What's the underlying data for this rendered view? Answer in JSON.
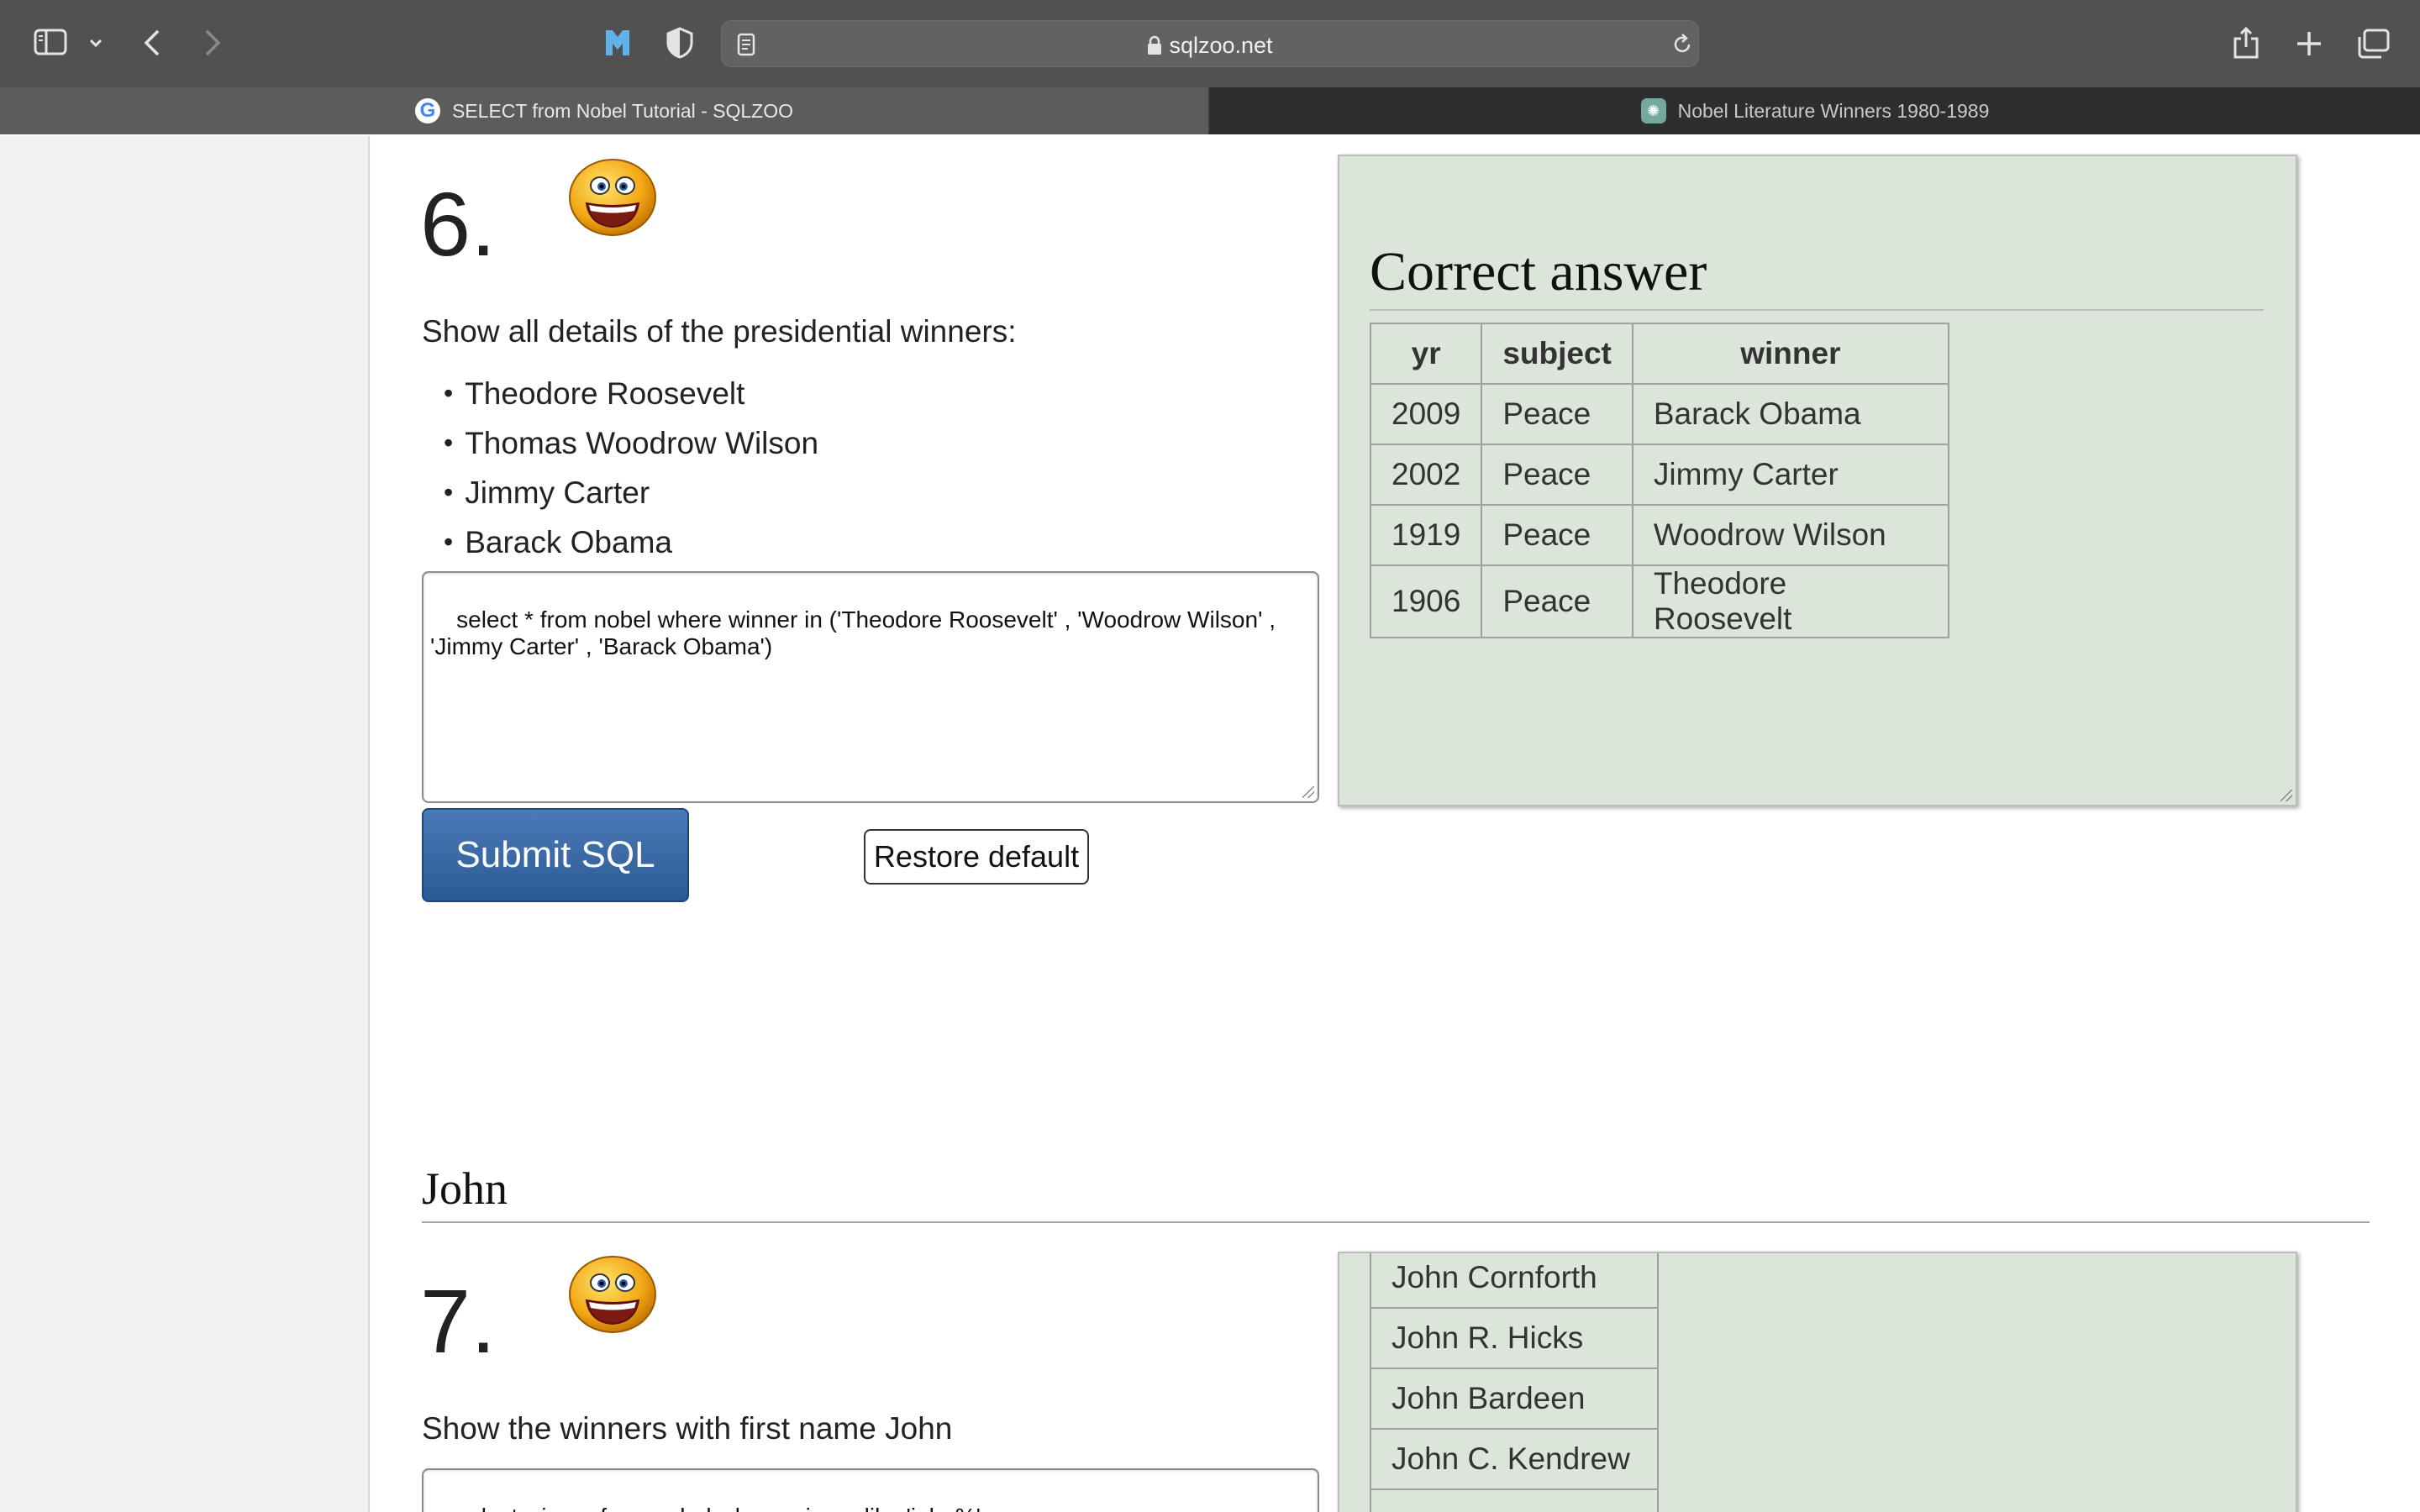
{
  "browser": {
    "url": "sqlzoo.net",
    "tabs": [
      {
        "title": "SELECT from Nobel Tutorial - SQLZOO",
        "active": true
      },
      {
        "title": "Nobel Literature Winners 1980-1989",
        "active": false
      }
    ]
  },
  "q6": {
    "number": "6.",
    "prompt": "Show all details of the presidential winners:",
    "bullets": [
      "Theodore Roosevelt",
      "Thomas Woodrow Wilson",
      "Jimmy Carter",
      "Barack Obama"
    ],
    "sql": "select * from nobel where winner in ('Theodore Roosevelt' , 'Woodrow Wilson' ,\n'Jimmy Carter' , 'Barack Obama')",
    "submit_label": "Submit SQL",
    "restore_label": "Restore default",
    "answer": {
      "title": "Correct answer",
      "columns": [
        "yr",
        "subject",
        "winner"
      ],
      "rows": [
        [
          "2009",
          "Peace",
          "Barack Obama"
        ],
        [
          "2002",
          "Peace",
          "Jimmy Carter"
        ],
        [
          "1919",
          "Peace",
          "Woodrow Wilson"
        ],
        [
          "1906",
          "Peace",
          "Theodore Roosevelt"
        ]
      ]
    }
  },
  "section": {
    "heading": "John"
  },
  "q7": {
    "number": "7.",
    "prompt": "Show the winners with first name John",
    "sql": "select winner from nobel where winner like 'john%'",
    "results": [
      "John Cornforth",
      "John R. Hicks",
      "John Bardeen",
      "John C. Kendrew"
    ]
  }
}
